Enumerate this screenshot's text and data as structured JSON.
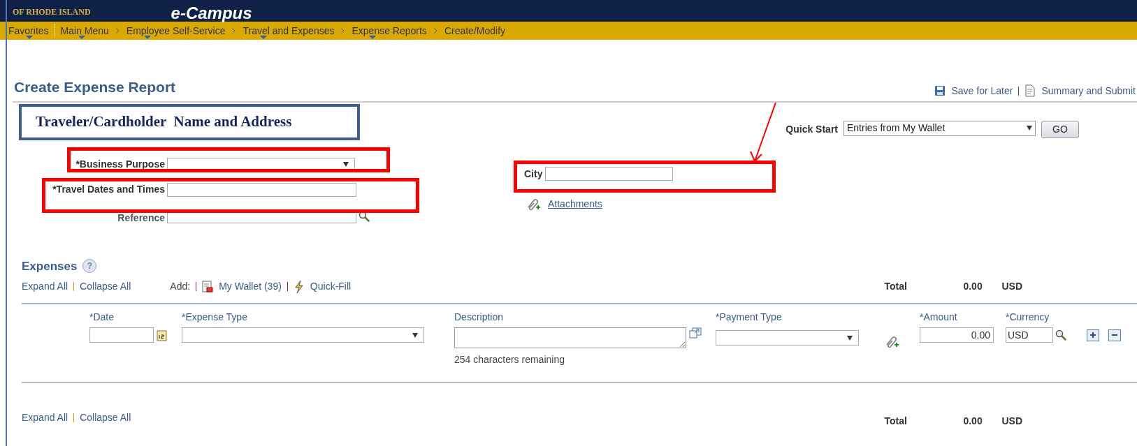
{
  "header": {
    "university": "OF RHODE ISLAND",
    "product": "e-Campus"
  },
  "breadcrumbs": [
    {
      "label": "Favorites",
      "menu": true
    },
    {
      "label": "Main Menu",
      "menu": true
    },
    {
      "label": "Employee Self-Service",
      "menu": true
    },
    {
      "label": "Travel and Expenses",
      "menu": true
    },
    {
      "label": "Expense Reports",
      "menu": true
    },
    {
      "label": "Create/Modify",
      "menu": false
    }
  ],
  "page_title": "Create Expense Report",
  "actions": [
    "Save for Later",
    "Summary and Submit"
  ],
  "callout": "Traveler/Cardholder  Name and Address",
  "form": {
    "business_purpose": "*Business Purpose",
    "travel_dates": "*Travel Dates and Times",
    "reference": "Reference",
    "city": "City",
    "attachments": "Attachments"
  },
  "quick_start": {
    "label": "Quick Start",
    "value": "Entries from My Wallet",
    "button": "GO"
  },
  "expenses": {
    "title": "Expenses",
    "help": "?",
    "expand_all": "Expand All",
    "collapse_all": "Collapse All",
    "add_label": "Add:",
    "my_wallet": "My Wallet (39)",
    "quick_fill": "Quick-Fill",
    "total_label": "Total",
    "total": "0.00",
    "total_currency": "USD",
    "columns": [
      "*Date",
      "*Expense Type",
      "Description",
      "*Payment Type",
      "*Amount",
      "*Currency"
    ],
    "row": {
      "amount": "0.00",
      "currency": "USD",
      "remaining": "254 characters remaining"
    },
    "footer": {
      "expand_all": "Expand All",
      "collapse_all": "Collapse All",
      "total_label": "Total",
      "total": "0.00",
      "total_currency": "USD"
    }
  }
}
